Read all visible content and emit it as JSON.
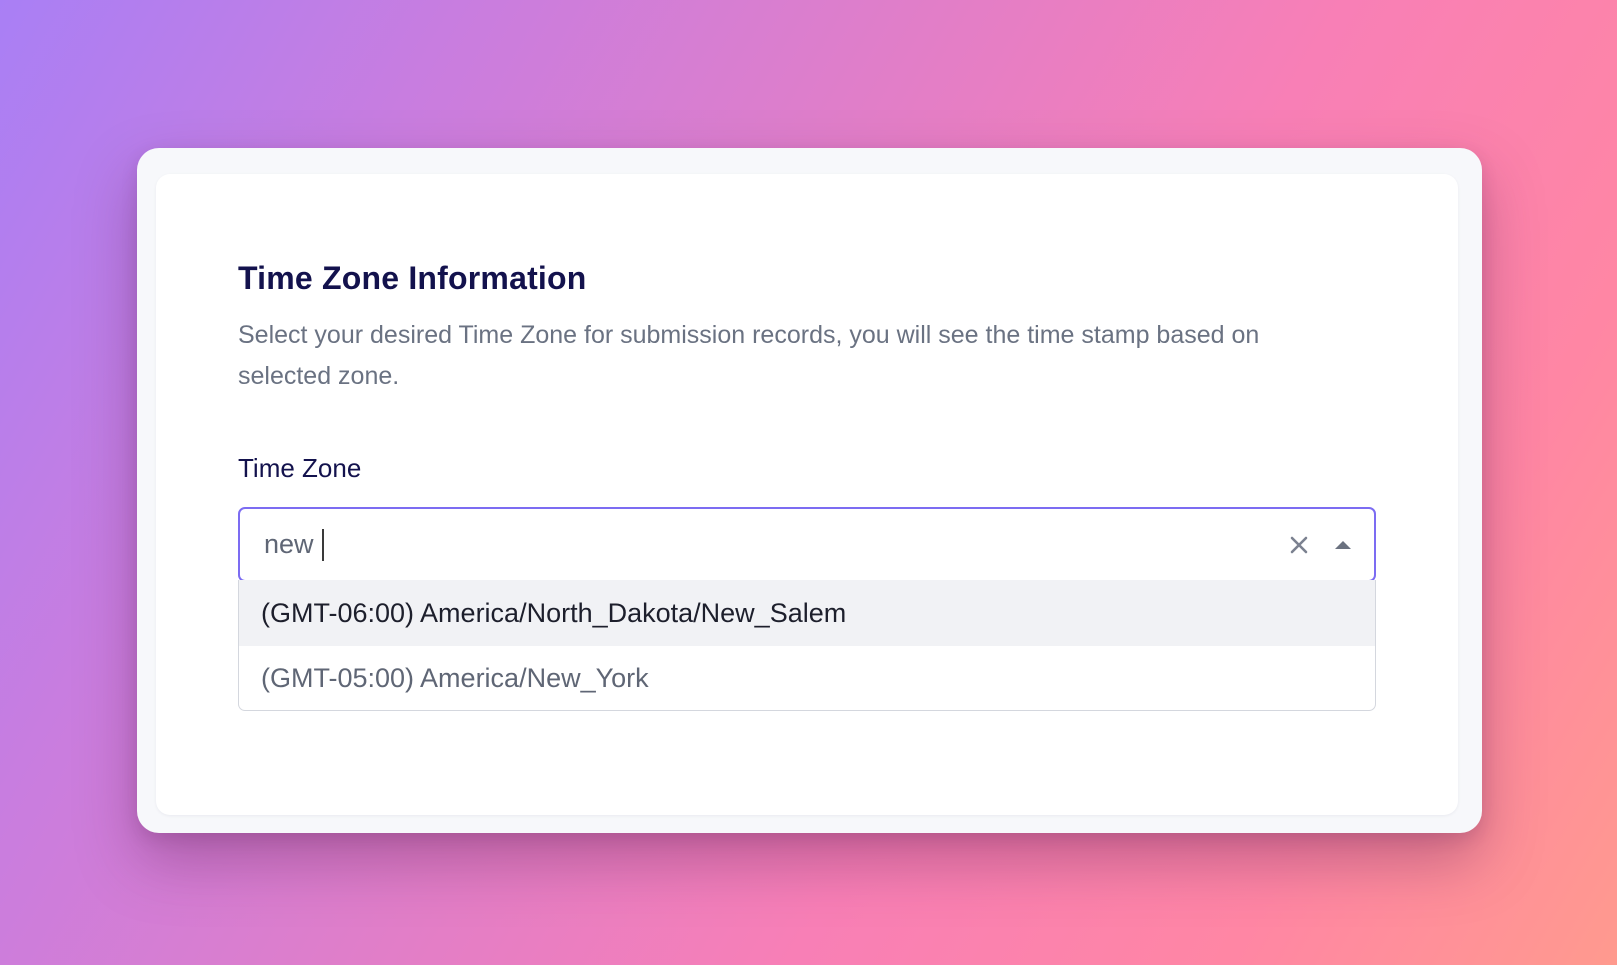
{
  "section": {
    "title": "Time Zone Information",
    "description": "Select your desired Time Zone for submission records, you will see the time stamp based on selected zone."
  },
  "field": {
    "label": "Time Zone",
    "search_value": "new"
  },
  "dropdown": {
    "options": [
      {
        "label": "(GMT-06:00) America/North_Dakota/New_Salem",
        "highlighted": true
      },
      {
        "label": "(GMT-05:00) America/New_York",
        "highlighted": false
      }
    ]
  },
  "icons": {
    "clear": "close-icon",
    "toggle": "caret-up-icon"
  },
  "colors": {
    "accent": "#7c6cf2",
    "title": "#13124d",
    "button": "#7a5cf5"
  }
}
